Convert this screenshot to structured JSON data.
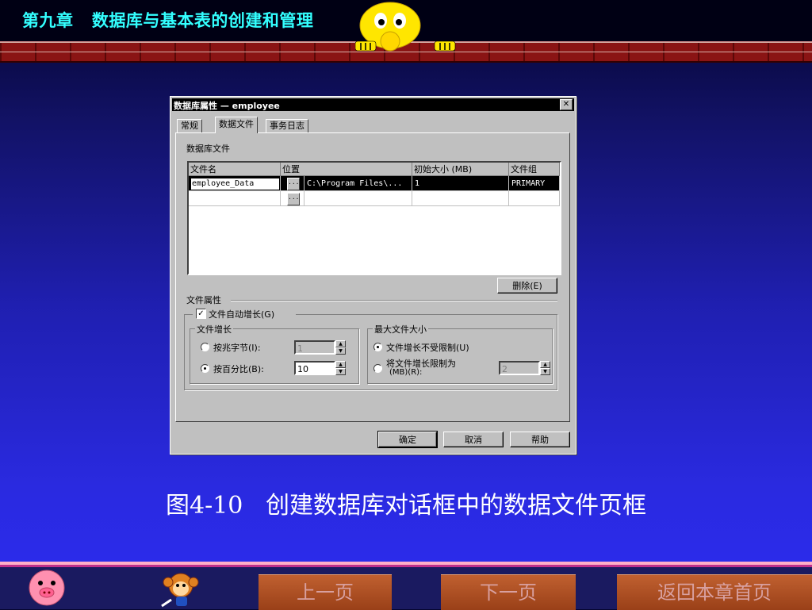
{
  "slide": {
    "chapter_title": "第九章   数据库与基本表的创建和管理",
    "caption": "图4-10   创建数据库对话框中的数据文件页框"
  },
  "dialog": {
    "title": "数据库属性 — employee",
    "close_glyph": "✕",
    "tabs": [
      "常规",
      "数据文件",
      "事务日志"
    ],
    "active_tab": "数据文件",
    "section_label": "数据库文件",
    "table": {
      "columns": [
        "文件名",
        "位置",
        "初始大小 (MB)",
        "文件组"
      ],
      "rows": [
        {
          "file_name": "employee_Data",
          "location": "C:\\Program Files\\...",
          "initial_size": "1",
          "filegroup": "PRIMARY",
          "selected": true
        },
        {
          "file_name": "",
          "location": "",
          "initial_size": "",
          "filegroup": "",
          "selected": false
        }
      ],
      "browse_label": "..."
    },
    "delete_button": "删除(E)",
    "file_props_label": "文件属性",
    "autogrow": {
      "label": "文件自动增长(G)",
      "checked": true
    },
    "growth_group": {
      "title": "文件增长",
      "by_mb": {
        "label": "按兆字节(I):",
        "value": "1",
        "selected": false
      },
      "by_percent": {
        "label": "按百分比(B):",
        "value": "10",
        "selected": true
      }
    },
    "max_size_group": {
      "title": "最大文件大小",
      "unrestricted": {
        "label": "文件增长不受限制(U)",
        "selected": true
      },
      "restrict": {
        "label_line1": "将文件增长限制为",
        "label_line2": "(MB)(R):",
        "value": "2",
        "selected": false
      }
    },
    "buttons": {
      "ok": "确定",
      "cancel": "取消",
      "help": "帮助"
    },
    "colors": {
      "dialog_face": "#c0c0c0",
      "selection": "#000000",
      "title_bar": "#000000"
    }
  },
  "nav": {
    "prev": "上一页",
    "next": "下一页",
    "back": "返回本章首页"
  },
  "theme": {
    "title_color": "#33ffff",
    "caption_color": "#ffffff",
    "nav_button_color": "#b05020"
  }
}
